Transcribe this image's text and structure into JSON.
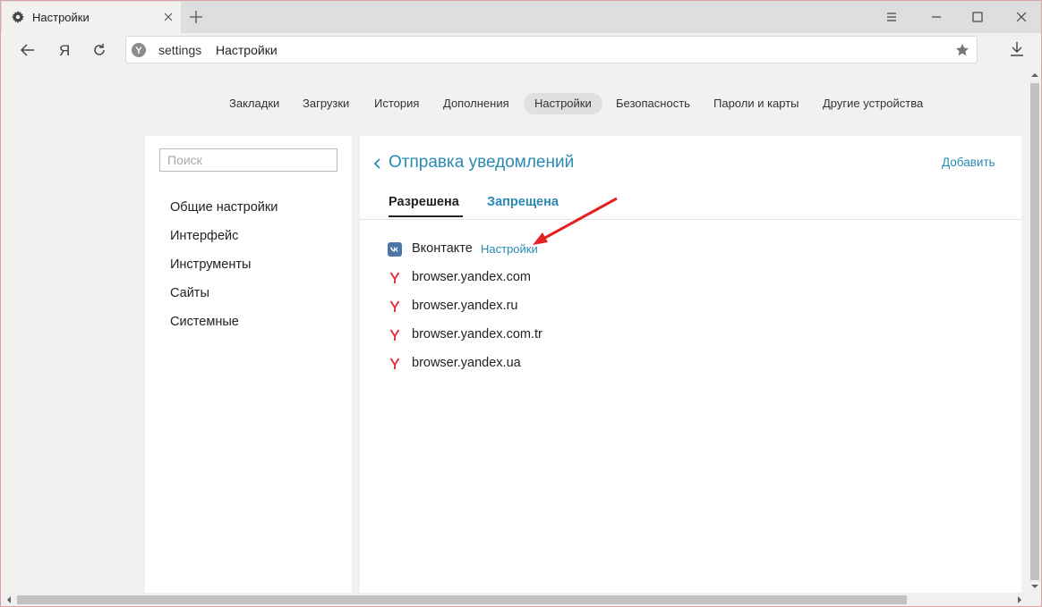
{
  "tab": {
    "title": "Настройки",
    "icon": "gear-icon"
  },
  "address": {
    "url_host": "settings",
    "url_title": "Настройки"
  },
  "topnav": {
    "items": [
      {
        "label": "Закладки",
        "active": false
      },
      {
        "label": "Загрузки",
        "active": false
      },
      {
        "label": "История",
        "active": false
      },
      {
        "label": "Дополнения",
        "active": false
      },
      {
        "label": "Настройки",
        "active": true
      },
      {
        "label": "Безопасность",
        "active": false
      },
      {
        "label": "Пароли и карты",
        "active": false
      },
      {
        "label": "Другие устройства",
        "active": false
      }
    ]
  },
  "sidebar": {
    "search_placeholder": "Поиск",
    "items": [
      {
        "label": "Общие настройки"
      },
      {
        "label": "Интерфейс"
      },
      {
        "label": "Инструменты"
      },
      {
        "label": "Сайты"
      },
      {
        "label": "Системные"
      }
    ]
  },
  "main": {
    "title": "Отправка уведомлений",
    "add_label": "Добавить",
    "tabs": [
      {
        "label": "Разрешена",
        "active": true
      },
      {
        "label": "Запрещена",
        "active": false
      }
    ],
    "sites": [
      {
        "name": "Вконтакте",
        "icon": "vk-icon",
        "settings_label": "Настройки"
      },
      {
        "name": "browser.yandex.com",
        "icon": "yandex-icon"
      },
      {
        "name": "browser.yandex.ru",
        "icon": "yandex-icon"
      },
      {
        "name": "browser.yandex.com.tr",
        "icon": "yandex-icon"
      },
      {
        "name": "browser.yandex.ua",
        "icon": "yandex-icon"
      }
    ]
  },
  "colors": {
    "accent": "#2a8ab5",
    "yandex_red": "#e8343f",
    "vk_blue": "#4a76a8",
    "annotation_arrow": "#e32121"
  }
}
